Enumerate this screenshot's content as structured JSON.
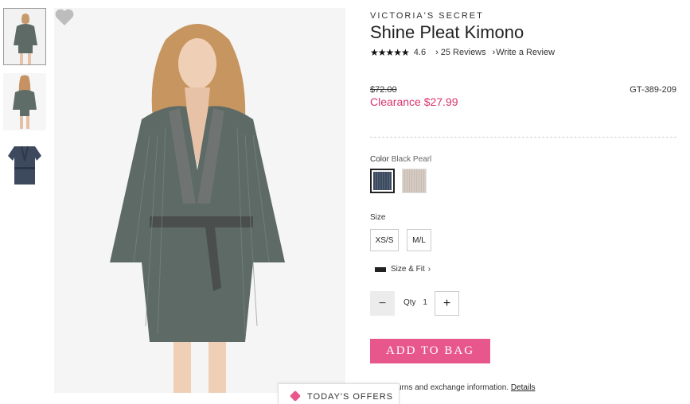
{
  "brand": "VICTORIA'S SECRET",
  "product": {
    "title": "Shine Pleat Kimono",
    "rating": "4.6",
    "stars": "★★★★★",
    "reviews": "25 Reviews",
    "write_review": "Write a Review",
    "original_price": "$72.00",
    "sale_price": "Clearance $27.99",
    "sku": "GT-389-209"
  },
  "color": {
    "label": "Color",
    "selected": "Black Pearl",
    "swatches": [
      {
        "name": "Black Pearl",
        "hex": "#3d4a5e"
      },
      {
        "name": "alt",
        "hex": "#d6cbc3"
      }
    ]
  },
  "size": {
    "label": "Size",
    "options": [
      "XS/S",
      "M/L"
    ],
    "size_fit": "Size & Fit"
  },
  "qty": {
    "label": "Qty",
    "value": "1",
    "minus": "−",
    "plus": "+"
  },
  "cta": {
    "add_to_bag": "ADD TO BAG"
  },
  "returns": {
    "text": "urns and exchange information.",
    "details": "Details"
  },
  "offers": {
    "label": "TODAY'S OFFERS"
  },
  "colors": {
    "accent": "#e8578c",
    "sale": "#d8336f",
    "robe": "#5d6a66"
  }
}
